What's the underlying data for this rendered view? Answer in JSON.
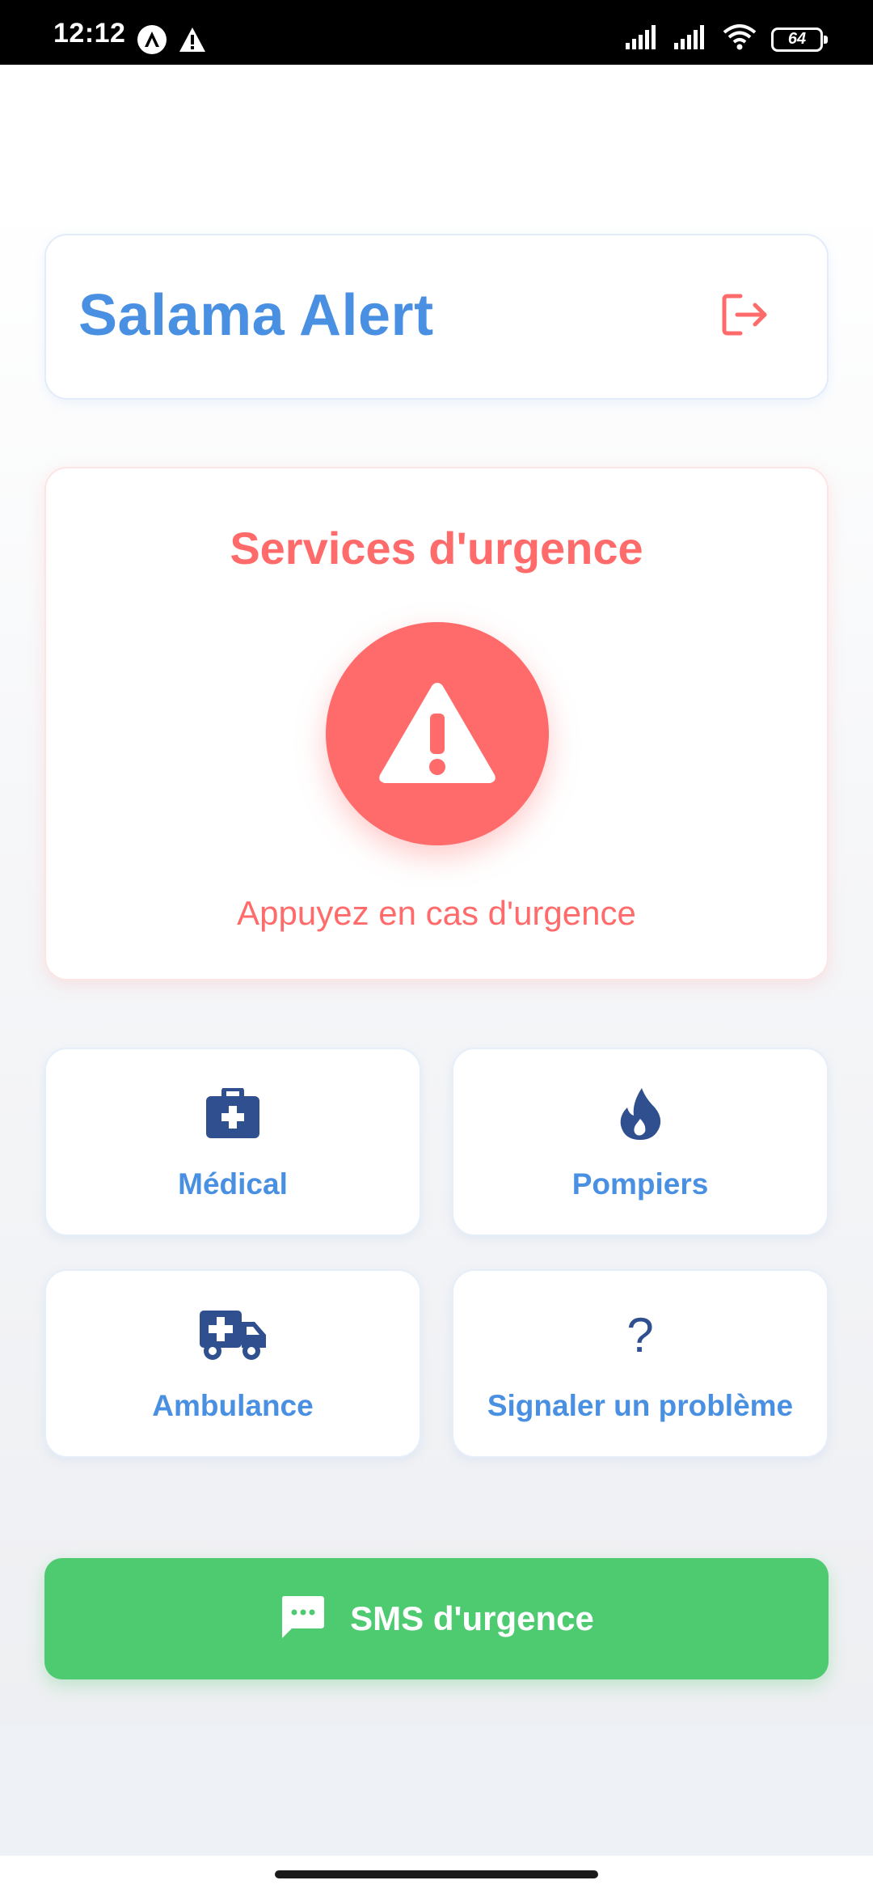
{
  "status_bar": {
    "time": "12:12",
    "battery": "64"
  },
  "header": {
    "title": "Salama Alert",
    "logout_icon": "logout-icon"
  },
  "emergency": {
    "title": "Services d'urgence",
    "icon": "warning-triangle-icon",
    "subtitle": "Appuyez en cas d'urgence"
  },
  "services": [
    {
      "label": "Médical",
      "icon": "medical-kit-icon"
    },
    {
      "label": "Pompiers",
      "icon": "fire-icon"
    },
    {
      "label": "Ambulance",
      "icon": "ambulance-icon"
    },
    {
      "label": "Signaler un problème",
      "icon": "question-icon"
    }
  ],
  "sms": {
    "label": "SMS d'urgence",
    "icon": "message-icon"
  },
  "colors": {
    "primary_blue": "#4a90e2",
    "alert_red": "#ff6b6b",
    "icon_navy": "#2f4f8f",
    "sms_green": "#4ecb71"
  }
}
